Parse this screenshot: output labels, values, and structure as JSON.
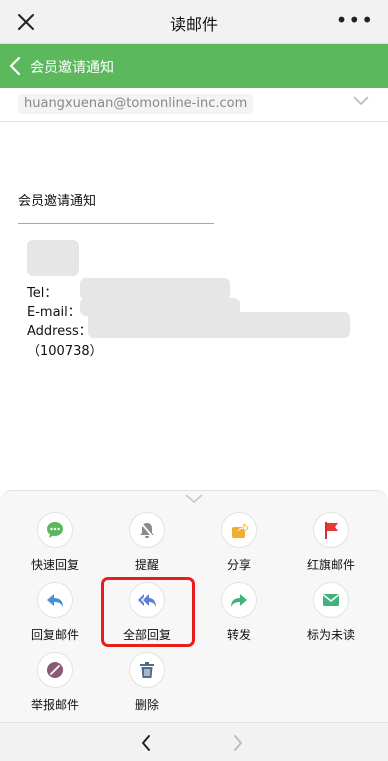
{
  "nav": {
    "title": "读邮件",
    "more_label": "•••"
  },
  "mail": {
    "subject_bar": "会员邀请通知",
    "from_address": "huangxuenan@tomonline-inc.com",
    "body_title": "会员邀请通知",
    "tel_label": "Tel：",
    "email_label": "E-mail：",
    "address_label": "Address：",
    "postal": "（100738）"
  },
  "actions": [
    {
      "label": "快速回复",
      "icon": "quick-reply-icon",
      "color": "#5cb85c"
    },
    {
      "label": "提醒",
      "icon": "bell-mute-icon",
      "color": "#7a7a7a"
    },
    {
      "label": "分享",
      "icon": "share-icon",
      "color": "#f0ad2f"
    },
    {
      "label": "红旗邮件",
      "icon": "red-flag-icon",
      "color": "#e53935"
    },
    {
      "label": "回复邮件",
      "icon": "reply-icon",
      "color": "#4a90d9"
    },
    {
      "label": "全部回复",
      "icon": "reply-all-icon",
      "color": "#5b7fd6"
    },
    {
      "label": "转发",
      "icon": "forward-icon",
      "color": "#3fb37a"
    },
    {
      "label": "标为未读",
      "icon": "mail-unread-icon",
      "color": "#3fb37a"
    },
    {
      "label": "举报邮件",
      "icon": "report-icon",
      "color": "#8a5a73"
    },
    {
      "label": "删除",
      "icon": "trash-icon",
      "color": "#4d6d8c"
    }
  ],
  "colors": {
    "header_green": "#5cb85c",
    "highlight_red": "#e81e1e"
  }
}
